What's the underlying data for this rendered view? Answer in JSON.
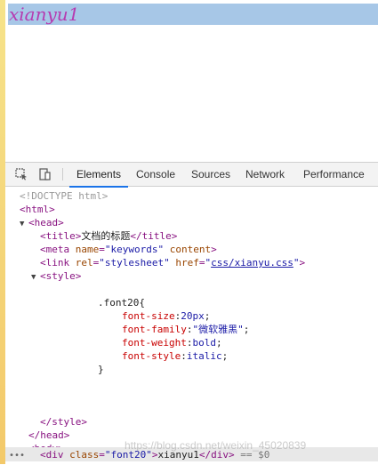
{
  "page": {
    "text": "xianyu1"
  },
  "devtools": {
    "tabs": [
      {
        "label": "Elements",
        "active": true
      },
      {
        "label": "Console",
        "active": false
      },
      {
        "label": "Sources",
        "active": false
      },
      {
        "label": "Network",
        "active": false
      },
      {
        "label": "Performance",
        "active": false
      }
    ],
    "icons": {
      "inspect": "inspect-element-icon",
      "device": "device-toolbar-icon"
    }
  },
  "dom": {
    "doctype": "<!DOCTYPE html>",
    "html_open": "<html>",
    "head_open": "<head>",
    "title_open": "<title>",
    "title_text": "文档的标题",
    "title_close": "</title>",
    "meta_tag": "<meta",
    "meta_name_attr": "name",
    "meta_name_val": "\"keywords\"",
    "meta_content_attr": "content",
    "meta_close": ">",
    "link_tag": "<link",
    "link_rel_attr": "rel",
    "link_rel_val": "\"stylesheet\"",
    "link_href_attr": "href",
    "link_href_q1": "\"",
    "link_href_val": "css/xianyu.css",
    "link_href_q2": "\"",
    "link_close": ">",
    "style_open": "<style>",
    "css_selector": ".font20{",
    "css_lines": [
      {
        "prop": "font-size",
        "val": "20px"
      },
      {
        "prop": "font-family",
        "val": "\"微软雅黑\""
      },
      {
        "prop": "font-weight",
        "val": "bold"
      },
      {
        "prop": "font-style",
        "val": "italic"
      }
    ],
    "css_close": "}",
    "style_close": "</style>",
    "head_close": "</head>",
    "body_open": "<body>",
    "div_open": "<div",
    "div_class_attr": "class",
    "div_class_val": "\"font20\"",
    "div_gt": ">",
    "div_text": "xianyu1",
    "div_close": "</div>",
    "div_selected": "== $0",
    "dots": "•••"
  },
  "watermark": "https://blog.csdn.net/weixin_45020839"
}
